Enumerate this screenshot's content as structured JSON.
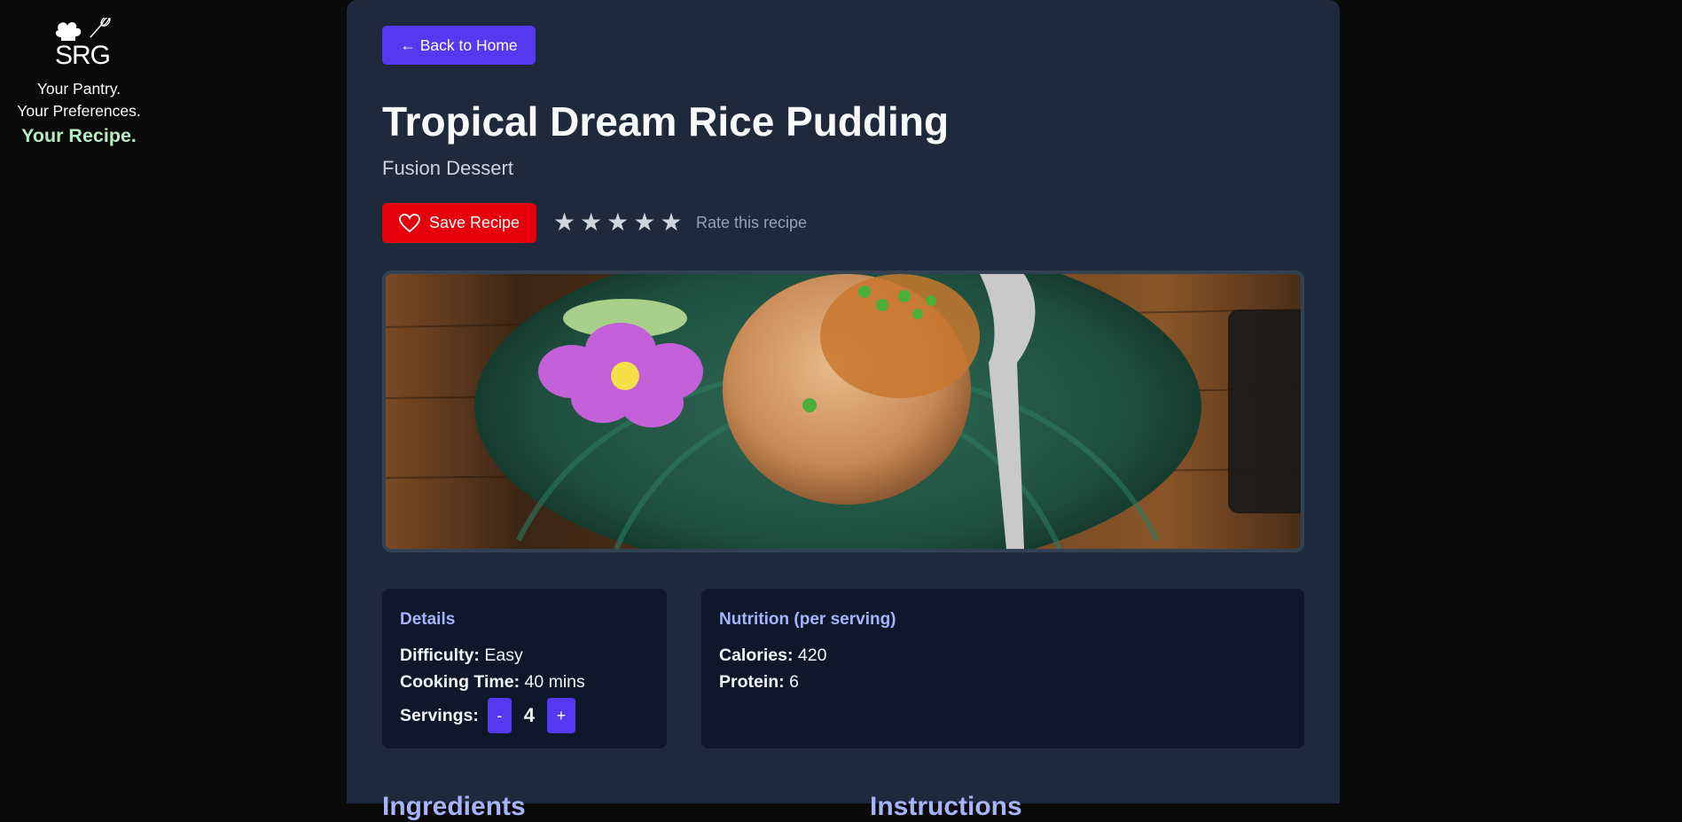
{
  "brand": {
    "logo_text": "SRG",
    "tag_line_1": "Your Pantry.",
    "tag_line_2": "Your Preferences.",
    "tag_line_3": "Your Recipe."
  },
  "nav": {
    "back_label": "← Back to Home"
  },
  "recipe": {
    "title": "Tropical Dream Rice Pudding",
    "cuisine": "Fusion Dessert",
    "save_label": "Save Recipe",
    "rating_prompt": "Rate this recipe",
    "stars": [
      "★",
      "★",
      "★",
      "★",
      "★"
    ]
  },
  "details": {
    "heading": "Details",
    "difficulty_label": "Difficulty:",
    "difficulty_value": "Easy",
    "time_label": "Cooking Time:",
    "time_value": "40 mins",
    "servings_label": "Servings:",
    "servings_value": "4",
    "minus_label": "-",
    "plus_label": "+"
  },
  "nutrition": {
    "heading": "Nutrition (per serving)",
    "calories_label": "Calories:",
    "calories_value": "420",
    "protein_label": "Protein:",
    "protein_value": "6"
  },
  "sections": {
    "ingredients": "Ingredients",
    "instructions": "Instructions"
  },
  "colors": {
    "accent": "#5538f0",
    "save": "#e5000c",
    "heading_accent": "#a5b4fc",
    "tagline_accent": "#b7ecc0"
  },
  "icons": {
    "save": "heart-icon",
    "logo": "chef-hat-whisk-icon",
    "rating": "star-icon"
  }
}
